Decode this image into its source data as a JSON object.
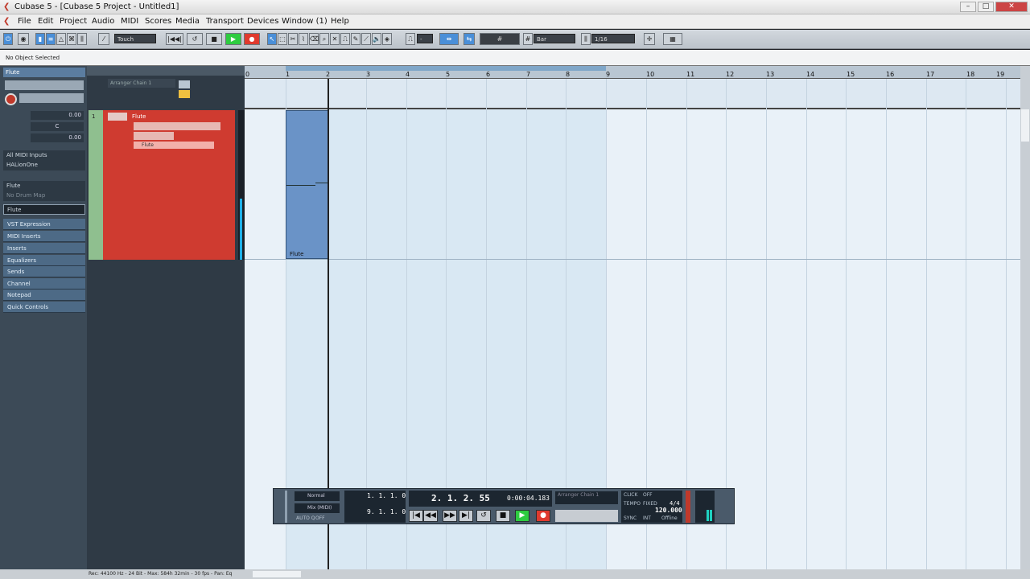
{
  "window": {
    "title": "Cubase 5 - [Cubase 5 Project - Untitled1]"
  },
  "menu": [
    "File",
    "Edit",
    "Project",
    "Audio",
    "MIDI",
    "Scores",
    "Media",
    "Transport",
    "Devices",
    "Window (1)",
    "Help"
  ],
  "toolbar": {
    "automation_mode": "Touch",
    "snap_type": "Bar",
    "quantize": "1/16"
  },
  "info_line": "No Object Selected",
  "inspector": {
    "track_name": "Flute",
    "volume": "0.00",
    "pan": "C",
    "delay": "0.00",
    "input": "All MIDI Inputs",
    "output": "HALionOne",
    "program": "Flute",
    "drum_map": "No Drum Map",
    "instrument": "Flute",
    "sections": [
      "VST Expression",
      "MIDI Inserts",
      "Inserts",
      "Equalizers",
      "Sends",
      "Channel",
      "Notepad",
      "Quick Controls"
    ]
  },
  "tracklist": {
    "arranger_chain": "Arranger Chain 1",
    "track": {
      "number": "1",
      "name": "Flute",
      "instrument": "Flute"
    }
  },
  "ruler": {
    "bars": [
      "0",
      "1",
      "2",
      "3",
      "4",
      "5",
      "6",
      "7",
      "8",
      "9",
      "10",
      "11",
      "12",
      "13",
      "14",
      "15",
      "16",
      "17",
      "18",
      "19"
    ]
  },
  "event": {
    "name": "Flute"
  },
  "transport": {
    "record_mode": "Normal",
    "mix_mode": "Mix (MIDI)",
    "auto_q": "AUTO Q",
    "auto_q_state": "OFF",
    "left_locator": "1. 1. 1. 0",
    "right_locator": "9. 1. 1. 0",
    "position_bars": "2. 1. 2. 55",
    "position_time": "0:00:04.183",
    "arranger": "Arranger Chain 1",
    "click_label": "CLICK",
    "click_state": "OFF",
    "tempo_label": "TEMPO",
    "tempo_mode": "FIXED",
    "signature": "4/4",
    "tempo": "120.000",
    "sync_label": "SYNC",
    "sync_source": "INT",
    "sync_state": "Offline"
  },
  "status": "Rec: 44100 Hz - 24 Bit - Max: 584h 32min - 30 fps - Pan: Eq"
}
